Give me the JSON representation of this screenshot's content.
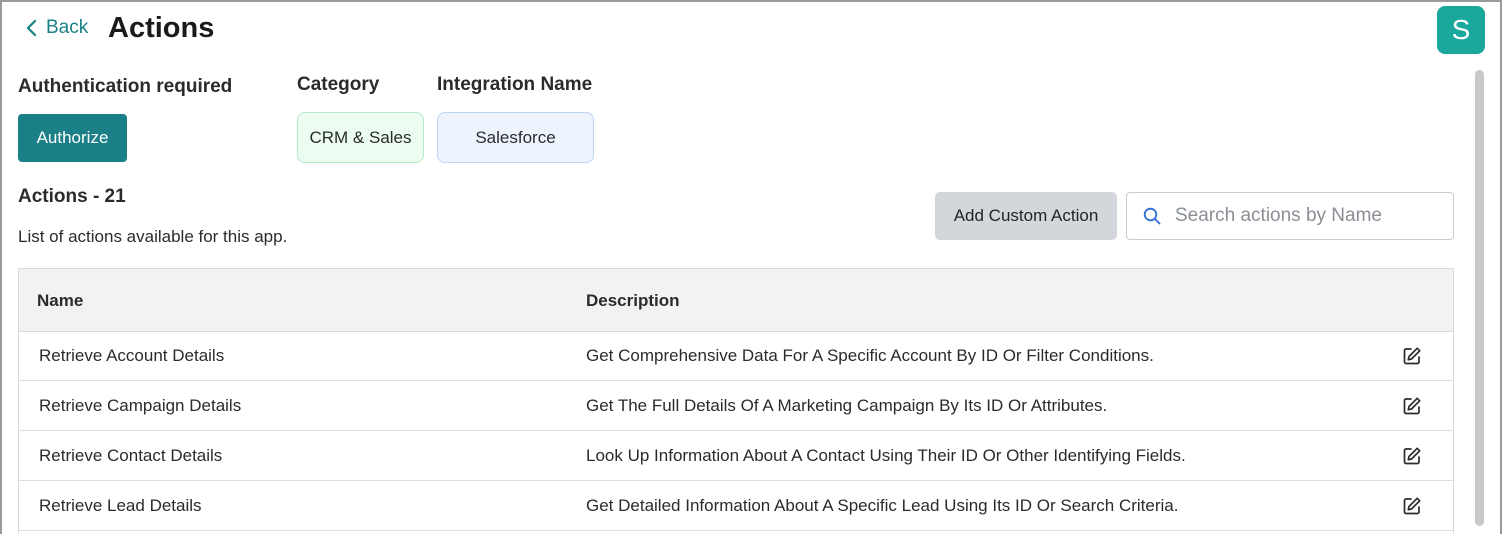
{
  "header": {
    "back_label": "Back",
    "title": "Actions",
    "avatar_initial": "S"
  },
  "meta": {
    "auth_label": "Authentication required",
    "authorize_label": "Authorize",
    "category_label": "Category",
    "category_value": "CRM & Sales",
    "integration_label": "Integration Name",
    "integration_value": "Salesforce"
  },
  "actions": {
    "title": "Actions - 21",
    "subtitle": "List of actions available for this app.",
    "add_custom_label": "Add Custom Action",
    "search_placeholder": "Search actions by Name"
  },
  "table": {
    "columns": {
      "name": "Name",
      "description": "Description"
    },
    "rows": [
      {
        "name": "Retrieve Account Details",
        "description": "Get Comprehensive Data For A Specific Account By ID Or Filter Conditions."
      },
      {
        "name": "Retrieve Campaign Details",
        "description": "Get The Full Details Of A Marketing Campaign By Its ID Or Attributes."
      },
      {
        "name": "Retrieve Contact Details",
        "description": "Look Up Information About A Contact Using Their ID Or Other Identifying Fields."
      },
      {
        "name": "Retrieve Lead Details",
        "description": "Get Detailed Information About A Specific Lead Using Its ID Or Search Criteria."
      }
    ]
  },
  "icons": {
    "back": "chevron-left-icon",
    "search": "search-icon",
    "edit": "edit-icon"
  },
  "colors": {
    "accent": "#1a7f86",
    "avatar": "#1aa89c",
    "category_chip_bg": "#edfcf1",
    "integration_chip_bg": "#eef4fd",
    "secondary_button": "#d3d6db"
  }
}
